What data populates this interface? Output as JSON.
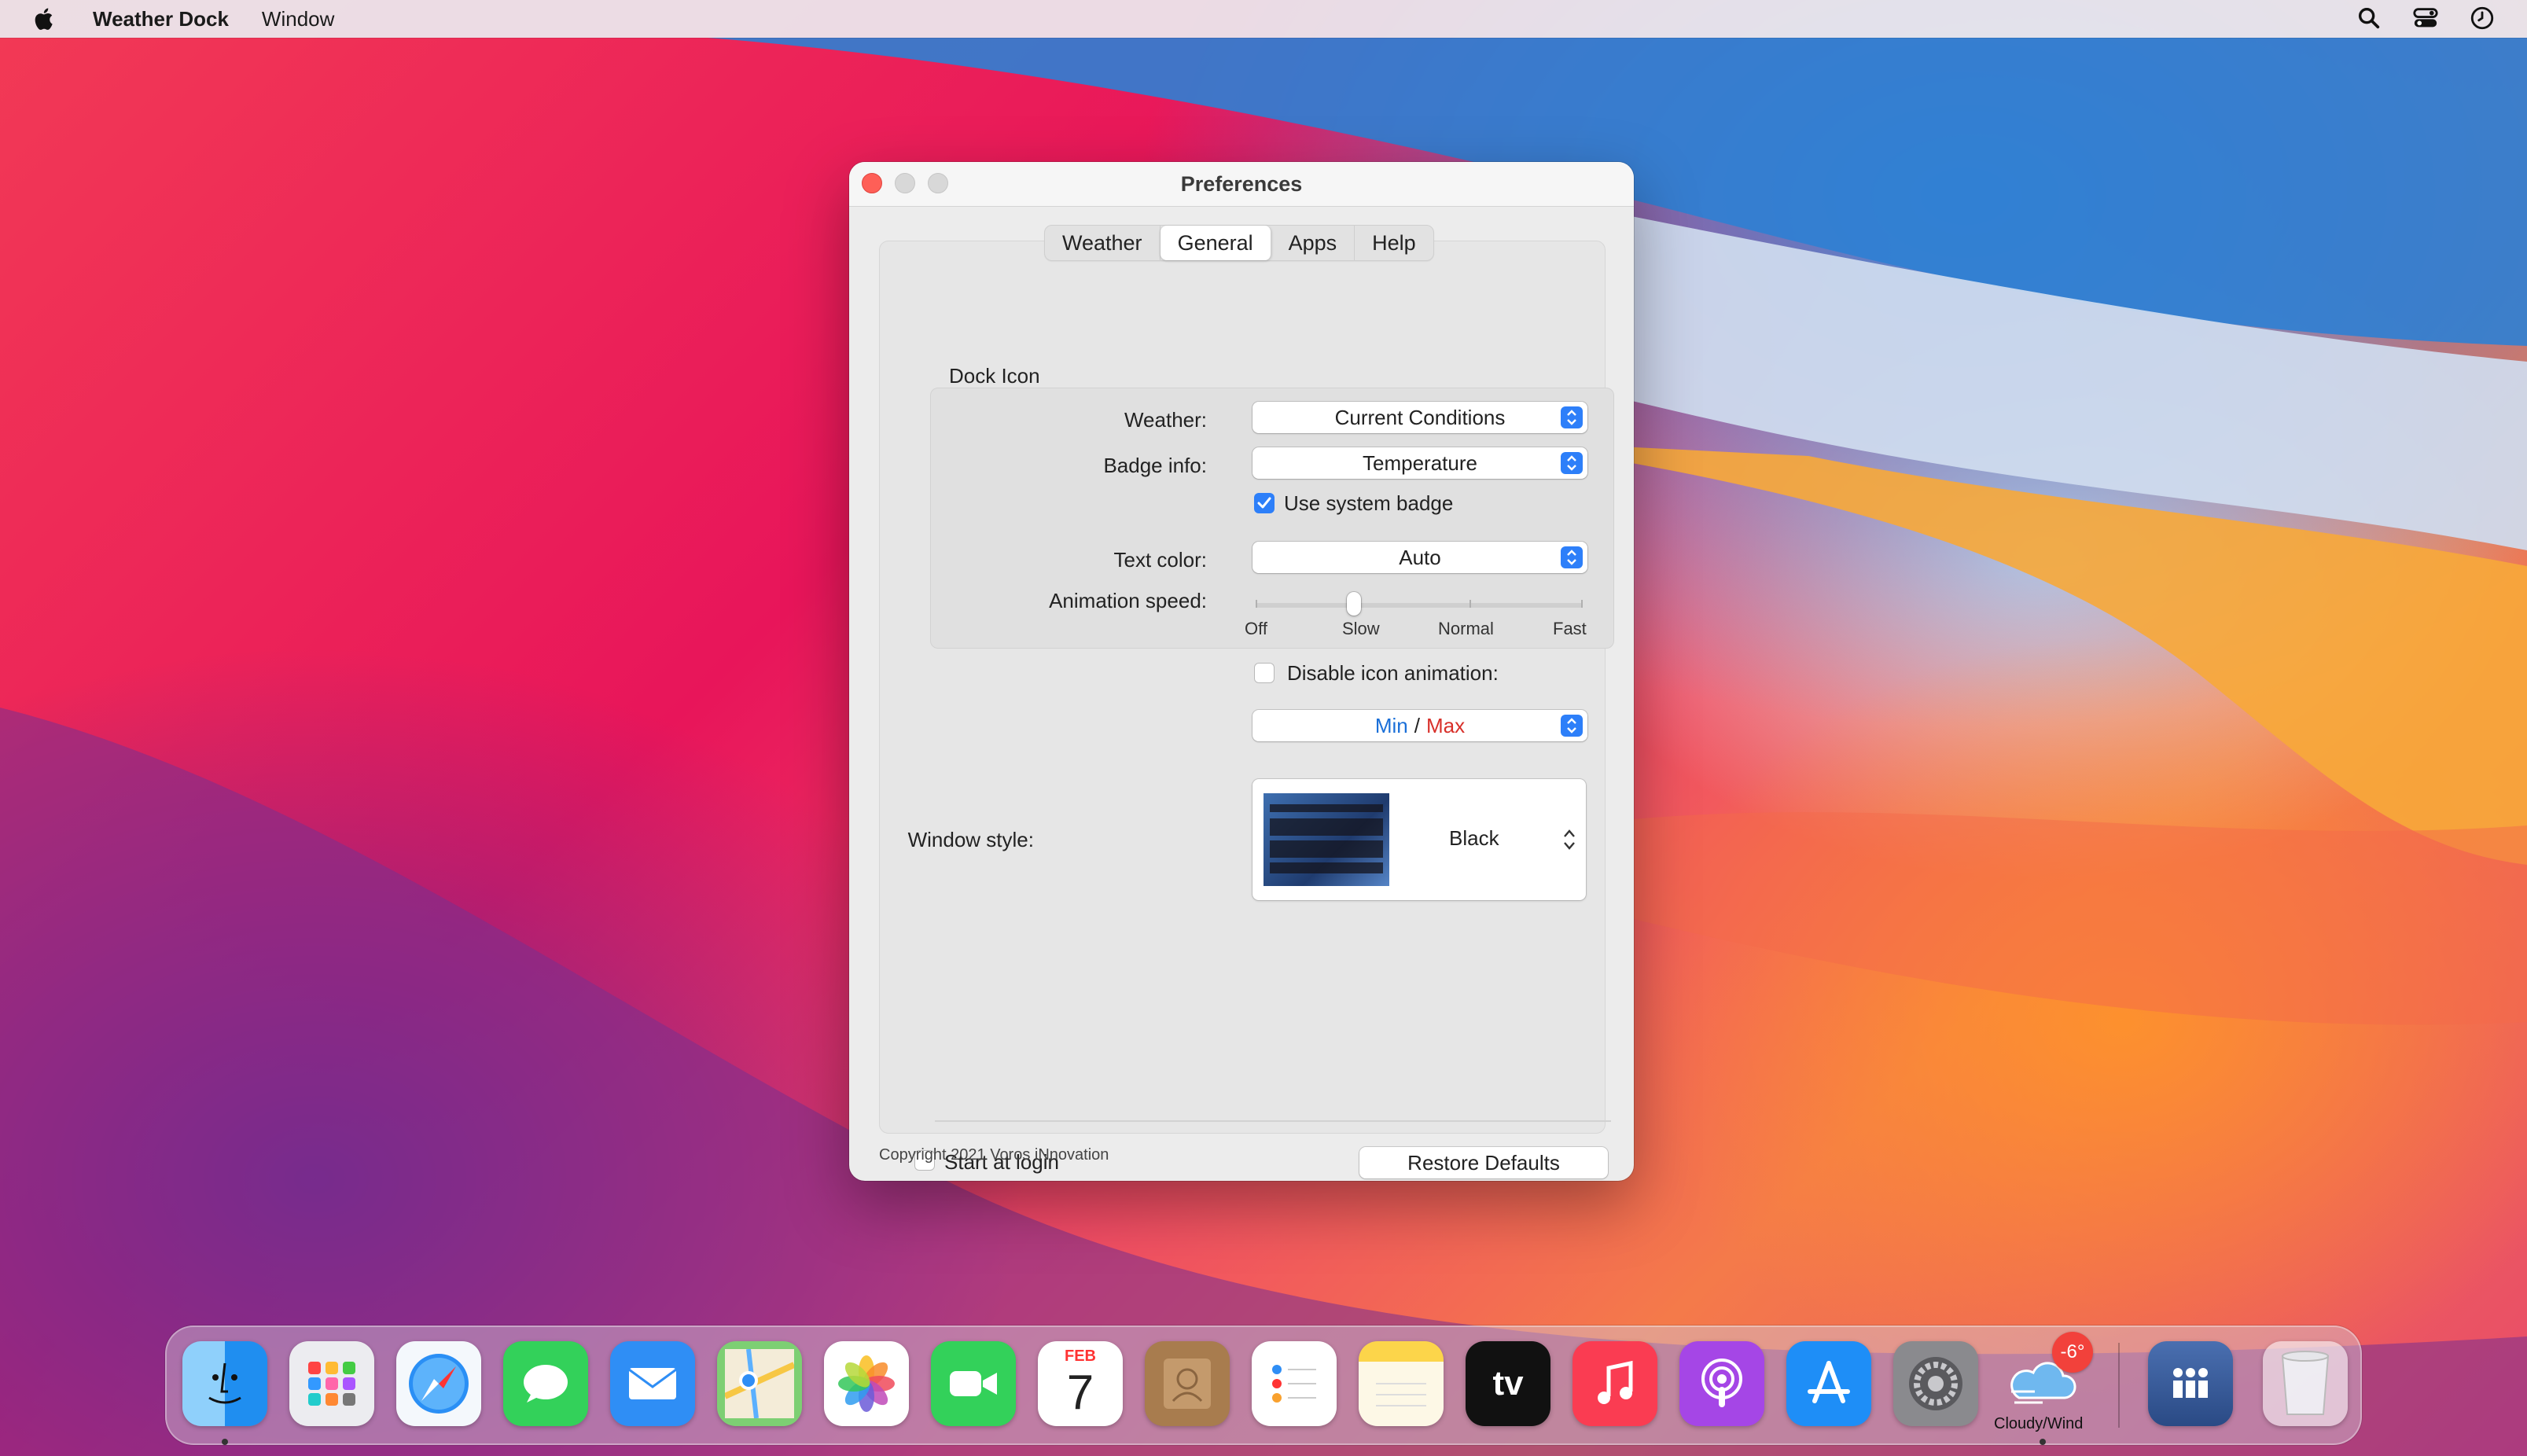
{
  "menubar": {
    "app_name": "Weather Dock",
    "menus": [
      "Window"
    ]
  },
  "window": {
    "title": "Preferences",
    "tabs": [
      {
        "label": "Weather",
        "active": false
      },
      {
        "label": "General",
        "active": true
      },
      {
        "label": "Apps",
        "active": false
      },
      {
        "label": "Help",
        "active": false
      }
    ],
    "dock_icon": {
      "section_label": "Dock Icon",
      "weather_label": "Weather:",
      "weather_value": "Current Conditions",
      "badge_label": "Badge info:",
      "badge_value": "Temperature",
      "system_badge_label": "Use system badge",
      "system_badge_checked": true,
      "text_color_label": "Text color:",
      "text_color_value": "Auto",
      "animation_label": "Animation speed:",
      "animation_ticks": [
        "Off",
        "Slow",
        "Normal",
        "Fast"
      ],
      "animation_selected": "Slow"
    },
    "disable_animation_label": "Disable icon animation:",
    "disable_animation_checked": false,
    "minmax": {
      "min": "Min",
      "sep": "/",
      "max": "Max",
      "min_color": "#1a6fd8",
      "max_color": "#d8302a"
    },
    "window_style_label": "Window style:",
    "window_style_value": "Black",
    "start_login_label": "Start at login",
    "start_login_checked": false,
    "restore_label": "Restore Defaults",
    "copyright": "Copyright 2021 Voros iNnovation"
  },
  "dock": {
    "apps": [
      {
        "name": "Finder",
        "icon": "finder-icon",
        "color": "#3aa0f0",
        "running": true
      },
      {
        "name": "Launchpad",
        "icon": "launchpad-icon",
        "color": "#e8e8ee",
        "running": false
      },
      {
        "name": "Safari",
        "icon": "safari-icon",
        "color": "#eaf4fd",
        "running": false
      },
      {
        "name": "Messages",
        "icon": "messages-icon",
        "color": "#2fcf56",
        "running": false
      },
      {
        "name": "Mail",
        "icon": "mail-icon",
        "color": "#2f8ef5",
        "running": false
      },
      {
        "name": "Maps",
        "icon": "maps-icon",
        "color": "#6cc96c",
        "running": false
      },
      {
        "name": "Photos",
        "icon": "photos-icon",
        "color": "#ffffff",
        "running": false
      },
      {
        "name": "FaceTime",
        "icon": "facetime-icon",
        "color": "#2fcf56",
        "running": false
      },
      {
        "name": "Calendar",
        "icon": "calendar-icon",
        "color": "#ffffff",
        "running": false,
        "month": "FEB",
        "day": "7"
      },
      {
        "name": "Contacts",
        "icon": "contacts-icon",
        "color": "#a57a4a",
        "running": false
      },
      {
        "name": "Reminders",
        "icon": "reminders-icon",
        "color": "#ffffff",
        "running": false
      },
      {
        "name": "Notes",
        "icon": "notes-icon",
        "color": "#fde68a",
        "running": false
      },
      {
        "name": "TV",
        "icon": "appletv-icon",
        "color": "#111111",
        "running": false,
        "label": "tv"
      },
      {
        "name": "Music",
        "icon": "music-icon",
        "color": "#fa3c52",
        "running": false
      },
      {
        "name": "Podcasts",
        "icon": "podcasts-icon",
        "color": "#a546e6",
        "running": false
      },
      {
        "name": "App Store",
        "icon": "appstore-icon",
        "color": "#1e8ef7",
        "running": false
      },
      {
        "name": "System Preferences",
        "icon": "system-preferences-icon",
        "color": "#8a8a8e",
        "running": false
      },
      {
        "name": "Weather Dock",
        "icon": "cloudy-wind-icon",
        "color": "transparent",
        "running": true,
        "badge": "-6°",
        "caption": "Cloudy/Wind"
      }
    ],
    "stack": {
      "icon": "users-folder-icon"
    },
    "trash": {
      "icon": "trash-icon"
    }
  }
}
